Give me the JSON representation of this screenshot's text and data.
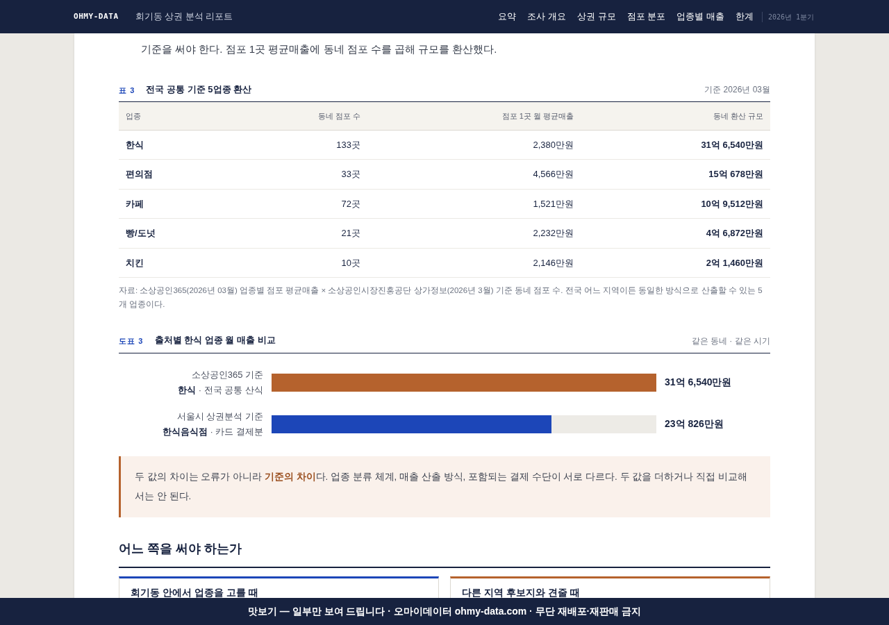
{
  "header": {
    "logo": "OHMY-DATA",
    "title": "회기동 상권 분석 리포트",
    "nav": [
      {
        "label": "요약"
      },
      {
        "label": "조사 개요"
      },
      {
        "label": "상권 규모"
      },
      {
        "label": "점포 분포"
      },
      {
        "label": "업종별 매출"
      },
      {
        "label": "한계"
      }
    ],
    "period": "2026년 1분기"
  },
  "intro_text": "기준을 써야 한다. 점포 1곳 평균매출에 동네 점포 수를 곱해 규모를 환산했다.",
  "table": {
    "label": "표 3",
    "title": "전국 공통 기준 5업종 환산",
    "note": "기준 2026년 03월",
    "columns": [
      "업종",
      "동네 점포 수",
      "점포 1곳 월 평균매출",
      "동네 환산 규모"
    ],
    "rows": [
      [
        "한식",
        "133곳",
        "2,380만원",
        "31억 6,540만원"
      ],
      [
        "편의점",
        "33곳",
        "4,566만원",
        "15억 678만원"
      ],
      [
        "카페",
        "72곳",
        "1,521만원",
        "10억 9,512만원"
      ],
      [
        "빵/도넛",
        "21곳",
        "2,232만원",
        "4억 6,872만원"
      ],
      [
        "치킨",
        "10곳",
        "2,146만원",
        "2억 1,460만원"
      ]
    ],
    "source": "자료: 소상공인365(2026년 03월) 업종별 점포 평균매출 × 소상공인시장진흥공단 상가정보(2026년 3월) 기준 동네 점포 수. 전국 어느 지역이든 동일한 방식으로 산출할 수 있는 5개 업종이다."
  },
  "figure": {
    "label": "도표 3",
    "title": "출처별 한식 업종 월 매출 비교",
    "note": "같은 동네 · 같은 시기",
    "bars": [
      {
        "source": "소상공인365 기준",
        "category": "**한식** · 전국 공통 산식",
        "level": 1,
        "color": "#b5622d",
        "value": "31억 6,540만원"
      },
      {
        "source": "서울시 상권분석 기준",
        "category": "**한식음식점** · 카드 결제분",
        "level": 0.728,
        "color": "#1c46b8",
        "value": "23억 826만원"
      }
    ]
  },
  "callout": "두 값의 차이는 오류가 아니라 **기준의 차이**다. 업종 분류 체계, 매출 산출 방식, 포함되는 결제 수단이 서로 다르다. 두 값을 더하거나 직접 비교해서는 안 된다.",
  "section": {
    "title": "어느 쪽을 써야 하는가",
    "cards": [
      {
        "title": "회기동 안에서 업종을 고를 때",
        "color": "#1c46b8"
      },
      {
        "title": "다른 지역 후보지와 견줄 때",
        "color": "#b5622d"
      }
    ]
  },
  "footer": "맛보기 — 일부만 보여 드립니다 · 오마이데이터 ohmy-data.com · 무단 재배포·재판매 금지"
}
